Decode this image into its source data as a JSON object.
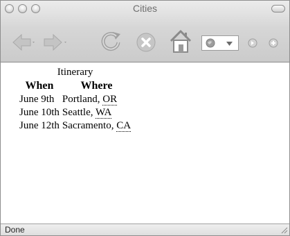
{
  "window": {
    "title": "Cities"
  },
  "toolbar": {
    "back_icon": "back-arrow-icon",
    "forward_icon": "forward-arrow-icon",
    "reload_icon": "reload-icon",
    "stop_icon": "stop-icon",
    "home_icon": "home-icon",
    "location_icon": "globe-icon",
    "go_icon": "go-icon",
    "search_icon": "search-icon"
  },
  "itinerary": {
    "caption": "Itinerary",
    "headers": [
      "When",
      "Where"
    ],
    "rows": [
      {
        "when": "June 9th",
        "city": "Portland, ",
        "state": "OR"
      },
      {
        "when": "June 10th",
        "city": "Seattle, ",
        "state": "WA"
      },
      {
        "when": "June 12th",
        "city": "Sacramento, ",
        "state": "CA"
      }
    ]
  },
  "status": {
    "text": "Done"
  },
  "colors": {
    "chrome_top": "#ececec",
    "chrome_bottom": "#cbcbcb",
    "icon_gray": "#b4b4b4",
    "content_bg": "#ffffff",
    "text": "#000000"
  }
}
